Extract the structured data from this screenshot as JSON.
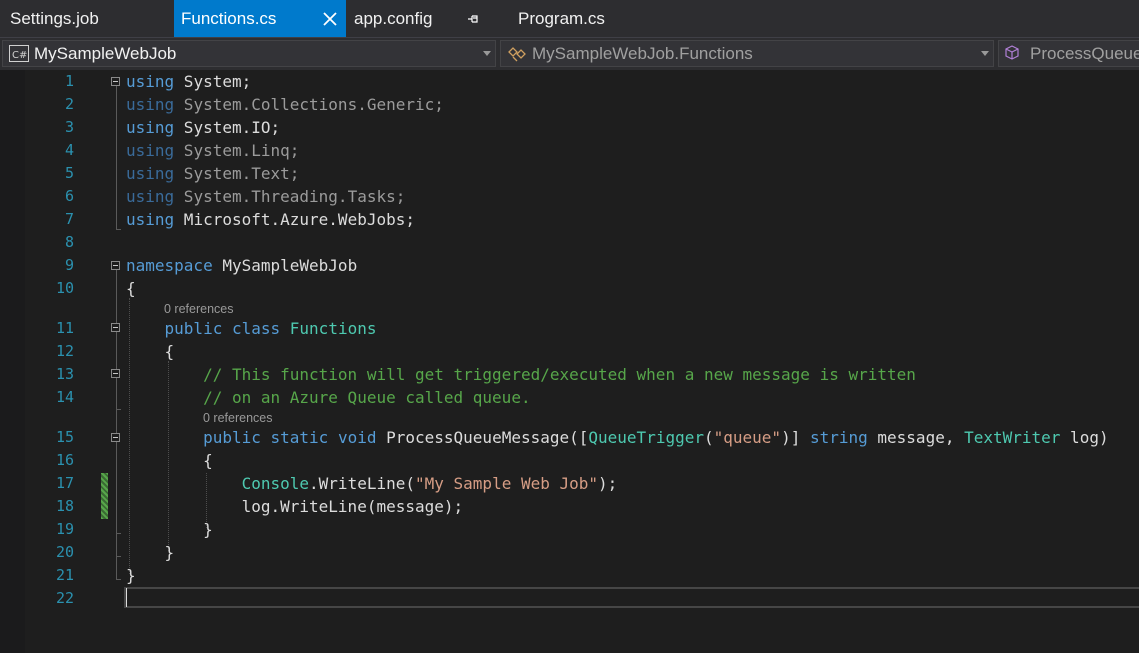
{
  "tabs": [
    {
      "label": "Settings.job",
      "active": false
    },
    {
      "label": "Functions.cs",
      "active": true
    },
    {
      "label": "app.config",
      "active": false
    },
    {
      "label": "Program.cs",
      "active": false
    }
  ],
  "navbar": {
    "project": {
      "icon": "csharp-project-icon",
      "label": "MySampleWebJob"
    },
    "type": {
      "icon": "class-icon",
      "label": "MySampleWebJob.Functions"
    },
    "member": {
      "icon": "method-cube-icon",
      "label": "ProcessQueueMessage"
    }
  },
  "code_lens": {
    "class_refs": "0 references",
    "method_refs": "0 references"
  },
  "editor": {
    "current_line": 22,
    "lines": [
      {
        "n": "1",
        "segs": [
          [
            "kw",
            "using"
          ],
          [
            "",
            "System;"
          ]
        ]
      },
      {
        "n": "2",
        "segs": [
          [
            "kwd",
            "using"
          ],
          [
            "dimtxt",
            "System.Collections.Generic;"
          ]
        ]
      },
      {
        "n": "3",
        "segs": [
          [
            "kw",
            "using"
          ],
          [
            "",
            "System.IO;"
          ]
        ]
      },
      {
        "n": "4",
        "segs": [
          [
            "kwd",
            "using"
          ],
          [
            "dimtxt",
            "System.Linq;"
          ]
        ]
      },
      {
        "n": "5",
        "segs": [
          [
            "kwd",
            "using"
          ],
          [
            "dimtxt",
            "System.Text;"
          ]
        ]
      },
      {
        "n": "6",
        "segs": [
          [
            "kwd",
            "using"
          ],
          [
            "dimtxt",
            "System.Threading.Tasks;"
          ]
        ]
      },
      {
        "n": "7",
        "segs": [
          [
            "kw",
            "using"
          ],
          [
            "",
            "Microsoft.Azure.WebJobs;"
          ]
        ]
      },
      {
        "n": "8",
        "segs": []
      },
      {
        "n": "9",
        "segs": [
          [
            "kw",
            "namespace"
          ],
          [
            "",
            "MySampleWebJob"
          ]
        ]
      },
      {
        "n": "10",
        "segs": [
          [
            "",
            "{"
          ]
        ]
      },
      {
        "n": "11",
        "segs": [
          [
            "",
            "    "
          ],
          [
            "kw",
            "public"
          ],
          [
            "",
            " "
          ],
          [
            "kw",
            "class"
          ],
          [
            "",
            " "
          ],
          [
            "typ",
            "Functions"
          ]
        ]
      },
      {
        "n": "12",
        "segs": [
          [
            "",
            "    {"
          ]
        ]
      },
      {
        "n": "13",
        "segs": [
          [
            "",
            "        "
          ],
          [
            "cmt",
            "// This function will get triggered/executed when a new message is written"
          ]
        ]
      },
      {
        "n": "14",
        "segs": [
          [
            "",
            "        "
          ],
          [
            "cmt",
            "// on an Azure Queue called queue."
          ]
        ]
      },
      {
        "n": "15",
        "segs": [
          [
            "",
            "        "
          ],
          [
            "kw",
            "public"
          ],
          [
            "",
            " "
          ],
          [
            "kw",
            "static"
          ],
          [
            "",
            " "
          ],
          [
            "kw",
            "void"
          ],
          [
            "",
            " ProcessQueueMessage(["
          ],
          [
            "typ",
            "QueueTrigger"
          ],
          [
            "",
            "("
          ],
          [
            "str",
            "\"queue\""
          ],
          [
            "",
            ")] "
          ],
          [
            "kw",
            "string"
          ],
          [
            "",
            " message, "
          ],
          [
            "typ",
            "TextWriter"
          ],
          [
            "",
            " log)"
          ]
        ]
      },
      {
        "n": "16",
        "segs": [
          [
            "",
            "        {"
          ]
        ]
      },
      {
        "n": "17",
        "segs": [
          [
            "",
            "            "
          ],
          [
            "typ",
            "Console"
          ],
          [
            "",
            ".WriteLine("
          ],
          [
            "str",
            "\"My Sample Web Job\""
          ],
          [
            "",
            ");"
          ]
        ]
      },
      {
        "n": "18",
        "segs": [
          [
            "",
            "            log.WriteLine(message);"
          ]
        ]
      },
      {
        "n": "19",
        "segs": [
          [
            "",
            "        }"
          ]
        ]
      },
      {
        "n": "20",
        "segs": [
          [
            "",
            "    }"
          ]
        ]
      },
      {
        "n": "21",
        "segs": [
          [
            "",
            "}"
          ]
        ]
      },
      {
        "n": "22",
        "segs": []
      }
    ]
  },
  "colors": {
    "background": "#1e1e1e",
    "keyword": "#569cd6",
    "type": "#4ec9b0",
    "string": "#d69d85",
    "comment": "#57a64a",
    "line_number": "#2b91af",
    "active_tab": "#007acc"
  }
}
